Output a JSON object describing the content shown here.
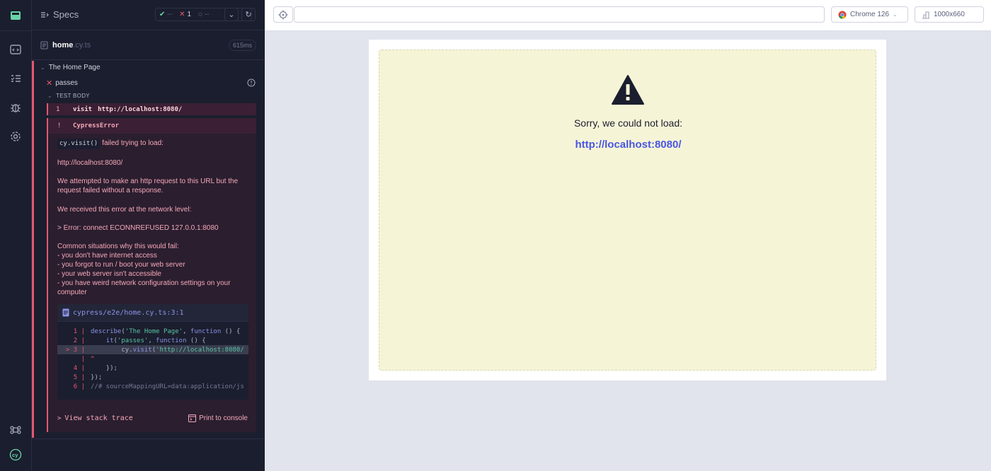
{
  "nav": {
    "items": [
      {
        "name": "specs-icon"
      },
      {
        "name": "runs-icon"
      },
      {
        "name": "debug-icon"
      },
      {
        "name": "settings-icon"
      }
    ],
    "shortcut_icon": "command-icon",
    "logo": "cypress-logo"
  },
  "reporter": {
    "title": "Specs",
    "stats": {
      "passed": "--",
      "failed": "1",
      "pending": "--"
    },
    "file": {
      "name": "home",
      "ext": ".cy.ts",
      "duration": "615ms"
    },
    "suite": "The Home Page",
    "test": "passes",
    "body_label": "TEST BODY",
    "command": {
      "num": "1",
      "name": "visit",
      "arg": "http://localhost:8080/"
    },
    "error": {
      "bang": "!",
      "title": "CypressError",
      "pill": "cy.visit()",
      "line1": "failed trying to load:",
      "url": "http://localhost:8080/",
      "p1": "We attempted to make an http request to this URL but the request failed without a response.",
      "p2": "We received this error at the network level:",
      "p3": "> Error: connect ECONNREFUSED 127.0.0.1:8080",
      "p4_title": "Common situations why this would fail:",
      "p4_items": [
        "- you don't have internet access",
        "- you forgot to run / boot your web server",
        "- your web server isn't accessible",
        "- you have weird network configuration settings on your computer"
      ],
      "codeframe_file": "cypress/e2e/home.cy.ts:3:1",
      "stack_label": "View stack trace",
      "print_label": "Print to console"
    }
  },
  "aut": {
    "browser": "Chrome 126",
    "viewport": "1000x660",
    "sorry": "Sorry, we could not load:",
    "url": "http://localhost:8080/"
  },
  "colors": {
    "fail": "#e45770",
    "link": "#4956e3",
    "panel": "#1b1e2e"
  }
}
